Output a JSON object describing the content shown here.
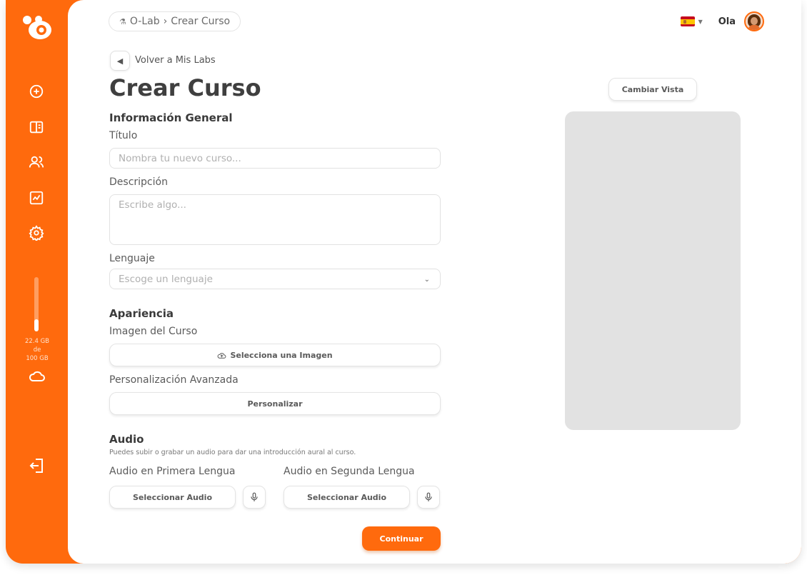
{
  "colors": {
    "accent": "#ff6a0d",
    "preview_bg": "#e2e2e2"
  },
  "sidebar": {
    "items": [
      {
        "icon": "plus-circle-icon"
      },
      {
        "icon": "book-icon"
      },
      {
        "icon": "users-icon"
      },
      {
        "icon": "chart-icon"
      },
      {
        "icon": "gear-icon"
      }
    ],
    "storage": {
      "used": "22.4 GB",
      "of": "de",
      "total": "100 GB",
      "used_fraction": 0.224
    },
    "logout_icon": "logout-icon"
  },
  "header": {
    "breadcrumb": {
      "root": "O-Lab",
      "separator": "›",
      "current": "Crear Curso"
    },
    "language_flag": "flag-spain-icon",
    "greeting": "Ola"
  },
  "form": {
    "back_label": "Volver a Mis Labs",
    "title": "Crear Curso",
    "general": {
      "heading": "Información General",
      "title_label": "Título",
      "title_placeholder": "Nombra tu nuevo curso...",
      "description_label": "Descripción",
      "description_placeholder": "Escribe algo...",
      "language_label": "Lenguaje",
      "language_placeholder": "Escoge un lenguaje"
    },
    "appearance": {
      "heading": "Apariencia",
      "image_label": "Imagen del Curso",
      "image_button": "Selecciona una Imagen",
      "custom_label": "Personalización Avanzada",
      "custom_button": "Personalizar"
    },
    "audio": {
      "heading": "Audio",
      "note": "Puedes subir o grabar un audio para dar una introducción aural al curso.",
      "first_label": "Audio en Primera Lengua",
      "second_label": "Audio en Segunda Lengua",
      "select_button": "Seleccionar Audio"
    },
    "continue": "Continuar"
  },
  "preview": {
    "toggle_label": "Cambiar Vista"
  }
}
